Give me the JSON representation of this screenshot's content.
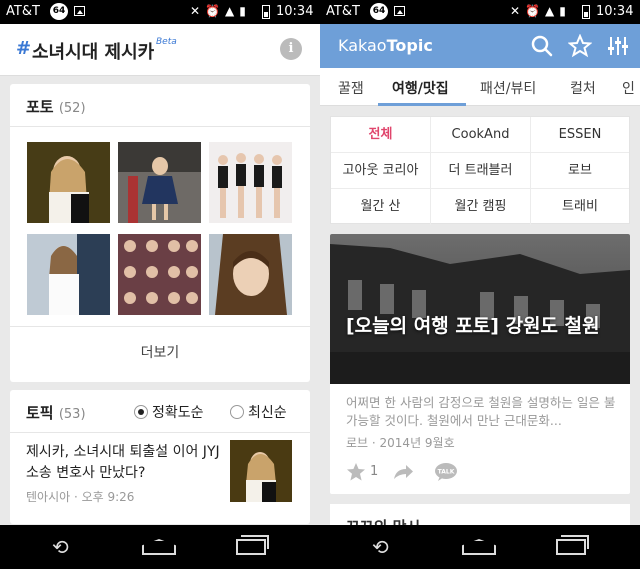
{
  "status_left": {
    "carrier": "AT&T",
    "badge": "64",
    "time": "10:34"
  },
  "status_right": {
    "carrier": "AT&T",
    "badge": "64",
    "time": "10:34"
  },
  "left": {
    "header": {
      "hash": "#",
      "title": "소녀시대 제시카",
      "beta": "Beta",
      "info_icon": "info-icon"
    },
    "photos": {
      "label": "포토",
      "count": "(52)",
      "more": "더보기"
    },
    "topics": {
      "label": "토픽",
      "count": "(53)",
      "sort_accuracy": "정확도순",
      "sort_latest": "최신순",
      "item_title": "제시카, 소녀시대 퇴출설 이어 JYJ 소송 변호사 만났다?",
      "item_meta": "텐아시아 · 오후 9:26"
    }
  },
  "right": {
    "header": {
      "logo_prefix": "Kakao",
      "logo_bold": "Topic"
    },
    "tabs": [
      "꿀잼",
      "여행/맛집",
      "패션/뷰티",
      "컬처",
      "인"
    ],
    "sources": [
      "전체",
      "CookAnd",
      "ESSEN",
      "고아웃 코리아",
      "더 트래블러",
      "로브",
      "월간 산",
      "월간 캠핑",
      "트래비"
    ],
    "article": {
      "title": "[오늘의 여행 포토] 강원도 철원",
      "summary": "어쩌면 한 사람의 감정으로 철원을 설명하는 일은 불가능할 것이다. 철원에서 만난 근대문화...",
      "meta": "로브 · 2014년 9월호",
      "like_count": "1",
      "talk_label": "TALK"
    },
    "next_card_title": "꼬꼬의 맛시"
  },
  "colors": {
    "accent_blue": "#6e9fd8",
    "hash_blue": "#3a78d4",
    "selected_pink": "#e0456c"
  }
}
